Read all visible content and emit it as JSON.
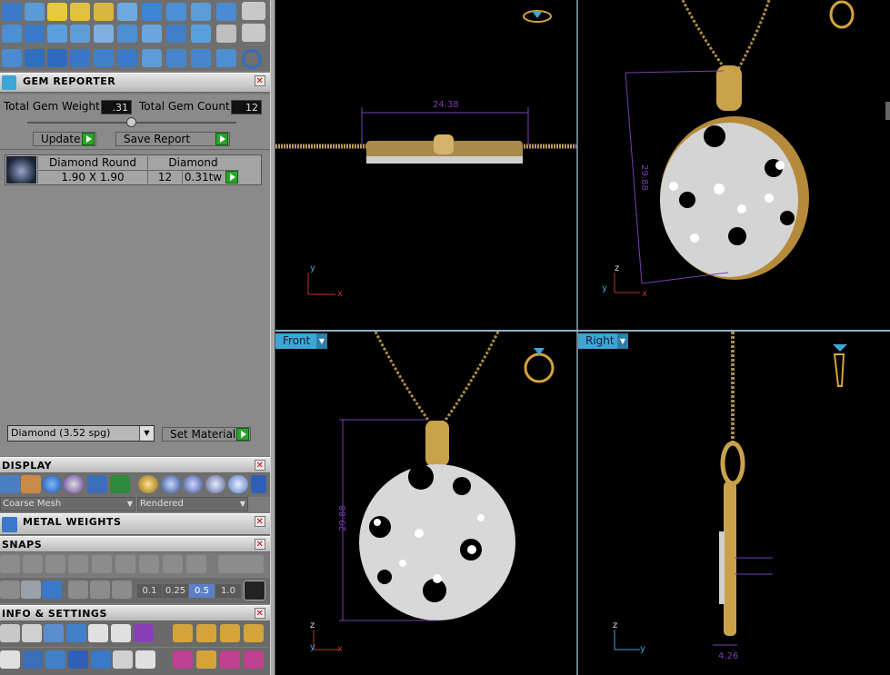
{
  "gem_reporter": {
    "title": "GEM REPORTER",
    "total_weight_label": "Total Gem Weight",
    "total_weight_value": ".31",
    "total_count_label": "Total Gem Count",
    "total_count_value": "12",
    "update_label": "Update",
    "save_report_label": "Save Report",
    "table": {
      "col1_header": "Diamond Round",
      "col2_header": "Diamond",
      "size": "1.90 X 1.90",
      "count": "12",
      "weight": "0.31tw"
    },
    "material_select": "Diamond    (3.52 spg)",
    "set_material_label": "Set Material"
  },
  "display": {
    "title": "DISPLAY",
    "mesh_select": "Coarse Mesh",
    "render_select": "Rendered"
  },
  "metal_weights": {
    "title": "METAL WEIGHTS"
  },
  "snaps": {
    "title": "SNAPS",
    "grid_values": [
      "0.1",
      "0.25",
      "0.5",
      "1.0"
    ]
  },
  "info_settings": {
    "title": "INFO & SETTINGS"
  },
  "viewports": {
    "front_label": "Front",
    "right_label": "Right",
    "dim_top": "24.38",
    "dim_persp": "29.88",
    "dim_front": "29.88",
    "dim_right": "4.26"
  },
  "axes": {
    "x": "x",
    "y": "y",
    "z": "z"
  },
  "colors": {
    "accent": "#3fa5d6",
    "gold": "#c9a24a",
    "dimension": "#7a3fb3"
  }
}
